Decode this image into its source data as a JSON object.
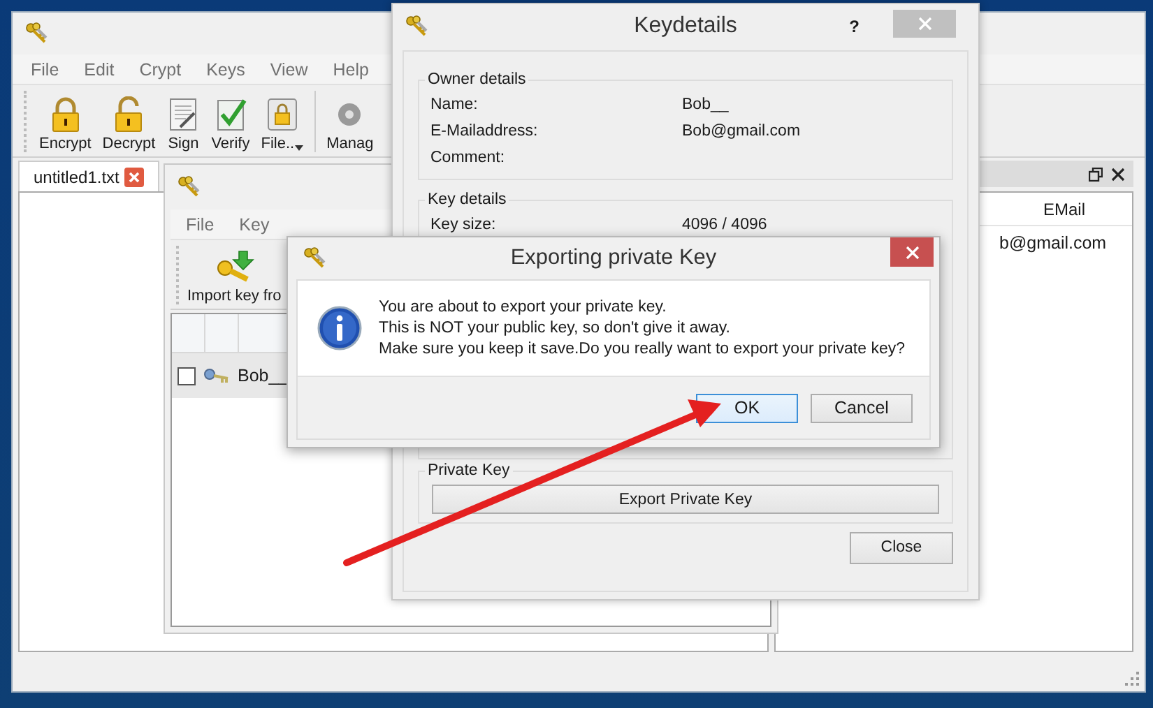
{
  "main_window": {
    "menu": [
      "File",
      "Edit",
      "Crypt",
      "Keys",
      "View",
      "Help"
    ],
    "toolbar": [
      {
        "label": "Encrypt",
        "kind": "lock",
        "dropdown": false
      },
      {
        "label": "Decrypt",
        "kind": "unlock",
        "dropdown": false
      },
      {
        "label": "Sign",
        "kind": "sign",
        "dropdown": false
      },
      {
        "label": "Verify",
        "kind": "verify",
        "dropdown": false
      },
      {
        "label": "File..",
        "kind": "file",
        "dropdown": true
      },
      {
        "label": "Manag",
        "kind": "manage",
        "dropdown": false
      }
    ],
    "tabs": [
      {
        "label": "untitled1.txt",
        "selected": true
      }
    ],
    "key_panel": {
      "columns": [
        "EMail"
      ],
      "rows": [
        [
          "b@gmail.com"
        ]
      ]
    }
  },
  "key_manager": {
    "menu": [
      "File",
      "Key"
    ],
    "toolbar": [
      {
        "label": "Import key fro",
        "kind": "import"
      }
    ],
    "keys": [
      {
        "name": "Bob__",
        "checked": false,
        "selected": true
      }
    ]
  },
  "keydetails": {
    "title": "Keydetails",
    "help": "?",
    "groups": [
      {
        "title": "Owner details",
        "fields": [
          {
            "label": "Name:",
            "value": "Bob__"
          },
          {
            "label": "E-Mailaddress:",
            "value": "Bob@gmail.com"
          },
          {
            "label": "Comment:"
          }
        ]
      },
      {
        "title": "Key details",
        "fields": [
          {
            "label": "Key size:",
            "value": "4096 / 4096"
          }
        ]
      },
      {
        "title": "Private Key",
        "button": "Export Private Key"
      }
    ],
    "close_button": "Close"
  },
  "export_dialog": {
    "title": "Exporting private Key",
    "message": "You are about to export your private key.\nThis is NOT your public key, so don't give it away.\nMake sure you keep it save.Do you really want to export your private key?",
    "buttons": [
      {
        "label": "OK",
        "focused": true
      },
      {
        "label": "Cancel",
        "focused": false
      }
    ]
  }
}
